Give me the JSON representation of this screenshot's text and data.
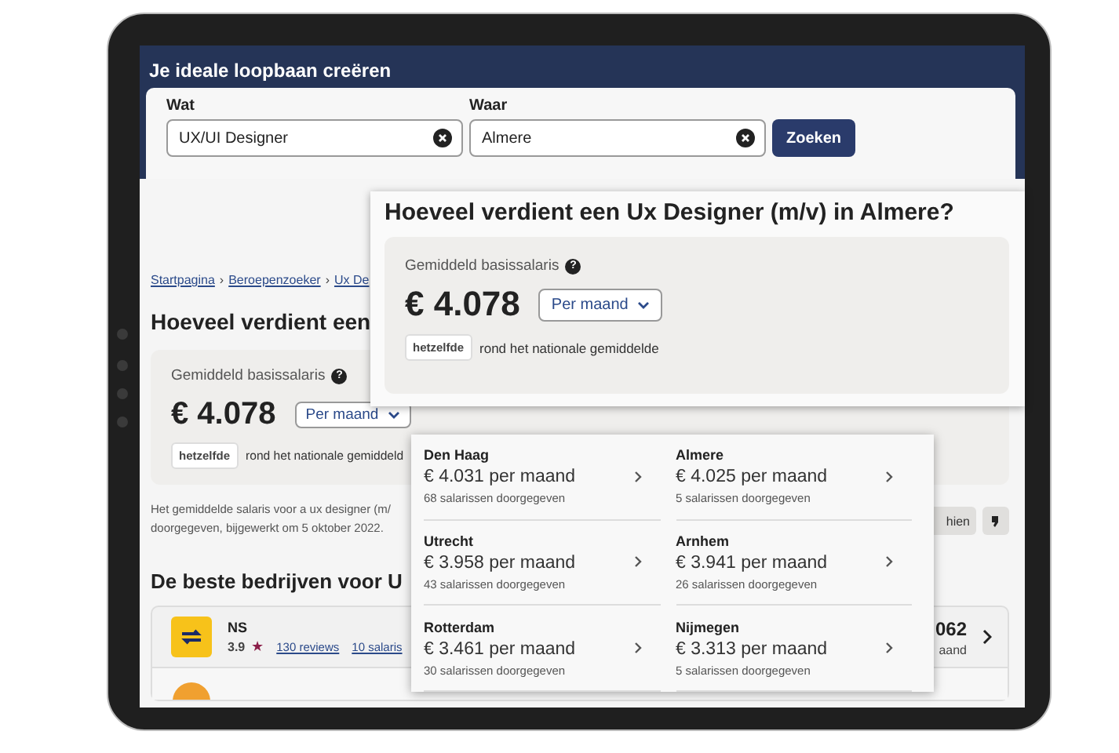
{
  "header": {
    "title": "Je ideale loopbaan creëren"
  },
  "search": {
    "fields": [
      {
        "label": "Wat",
        "value": "UX/UI Designer"
      },
      {
        "label": "Waar",
        "value": "Almere"
      }
    ],
    "button": "Zoeken"
  },
  "breadcrumbs": [
    "Startpagina",
    "Beroepenzoeker",
    "Ux De"
  ],
  "breadcrumb_separator": "›",
  "heading": "Hoeveel verdient een",
  "salary": {
    "label": "Gemiddeld basissalaris",
    "help": "?",
    "amount": "€ 4.078",
    "period": "Per maand",
    "badge": "hetzelfde",
    "comparison": "rond het nationale gemiddeld"
  },
  "note": [
    "Het gemiddelde salaris voor a ux designer (m/",
    "doorgegeven, bijgewerkt om 5 oktober 2022."
  ],
  "feedback_button": "hien",
  "companies_heading": "De beste bedrijven voor U",
  "companies": [
    {
      "name": "NS",
      "rating": "3.9",
      "star": "★",
      "links": [
        "130 reviews",
        "10 salaris"
      ],
      "salary": "062",
      "period": "aand"
    }
  ],
  "zoom_card": {
    "title": "Hoeveel verdient een Ux Designer (m/v) in Almere?",
    "label": "Gemiddeld basissalaris",
    "help": "?",
    "amount": "€ 4.078",
    "period": "Per maand",
    "badge": "hetzelfde",
    "comparison": "rond het nationale gemiddelde"
  },
  "cities": [
    {
      "name": "Den Haag",
      "salary": "€ 4.031 per maand",
      "count": "68 salarissen doorgegeven"
    },
    {
      "name": "Almere",
      "salary": "€ 4.025 per maand",
      "count": "5 salarissen doorgegeven"
    },
    {
      "name": "Utrecht",
      "salary": "€ 3.958 per maand",
      "count": "43 salarissen doorgegeven"
    },
    {
      "name": "Arnhem",
      "salary": "€ 3.941 per maand",
      "count": "26 salarissen doorgegeven"
    },
    {
      "name": "Rotterdam",
      "salary": "€ 3.461 per maand",
      "count": "30 salarissen doorgegeven"
    },
    {
      "name": "Nijmegen",
      "salary": "€ 3.313 per maand",
      "count": "5 salarissen doorgegeven"
    }
  ]
}
